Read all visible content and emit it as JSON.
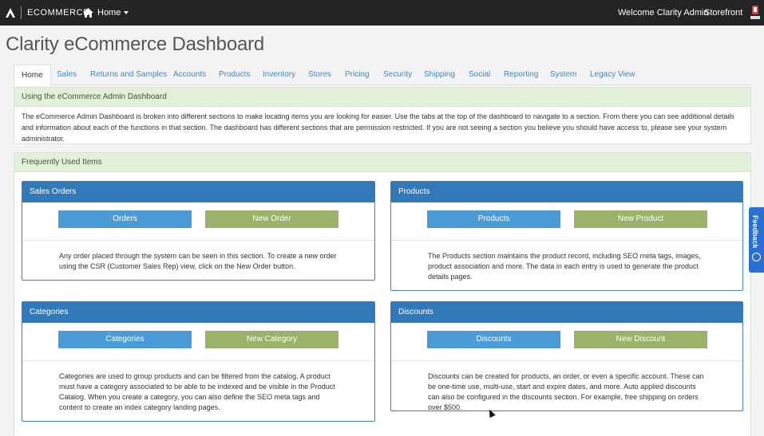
{
  "navbar": {
    "brand": "ECOMMERCE",
    "home": "Home",
    "welcome": "Welcome Clarity Admin",
    "storefront": "Storefront"
  },
  "page_title": "Clarity eCommerce Dashboard",
  "tabs": [
    "Home",
    "Sales",
    "Returns and Samples",
    "Accounts",
    "Products",
    "Inventory",
    "Stores",
    "Pricing",
    "Security",
    "Shipping",
    "Social",
    "Reporting",
    "System",
    "Legacy View"
  ],
  "intro": {
    "heading": "Using the eCommerce Admin Dashboard",
    "text": "The eCommerce Admin Dashboard is broken into different sections to make locating items you are looking for easier. Use the tabs at the top of the dashboard to navigate to a section. From there you can see additional details and information about each of the functions in that section. The dashboard has different sections that are permission restricted. If you are not seeing a section you believe you should have access to, please see your system administrator."
  },
  "frequent": {
    "heading": "Frequently Used Items"
  },
  "cards": [
    {
      "title": "Sales Orders",
      "primary": "Orders",
      "secondary": "New Order",
      "text": "Any order placed through the system can be seen in this section. To create a new order using the CSR (Customer Sales Rep) view, click on the New Order button."
    },
    {
      "title": "Products",
      "primary": "Products",
      "secondary": "New Product",
      "text": "The Products section maintains the product record, including SEO meta tags, images, product association and more. The data in each entry is used to generate the product details pages."
    },
    {
      "title": "Categories",
      "primary": "Categories",
      "secondary": "New Category",
      "text": "Categories are used to group products and can be filtered from the catalog. A product must have a category associated to be able to be indexed and be visible in the Product Catalog. When you create a category, you can also define the SEO meta tags and content to create an index category landing pages."
    },
    {
      "title": "Discounts",
      "primary": "Discounts",
      "secondary": "New Discount",
      "text": "Discounts can be created for products, an order, or even a specific account. These can be one-time use, multi-use, start and expire dates, and more. Auto applied discounts can also be configured in the discounts section. For example, free shipping on orders over $500."
    }
  ],
  "feedback": {
    "label": "Feedback"
  },
  "icons": {
    "brand": "brand-logo-icon",
    "home": "home-icon",
    "storefront_logo": "storefront-logo-icon",
    "feedback": "feedback-icon"
  },
  "colors": {
    "navbar": "#222426",
    "card_header": "#3379b8",
    "primary_button": "#4a9bd6",
    "secondary_button": "#9cb26a",
    "info_header": "#e2efd9",
    "tab_link": "#3a8bc9"
  }
}
